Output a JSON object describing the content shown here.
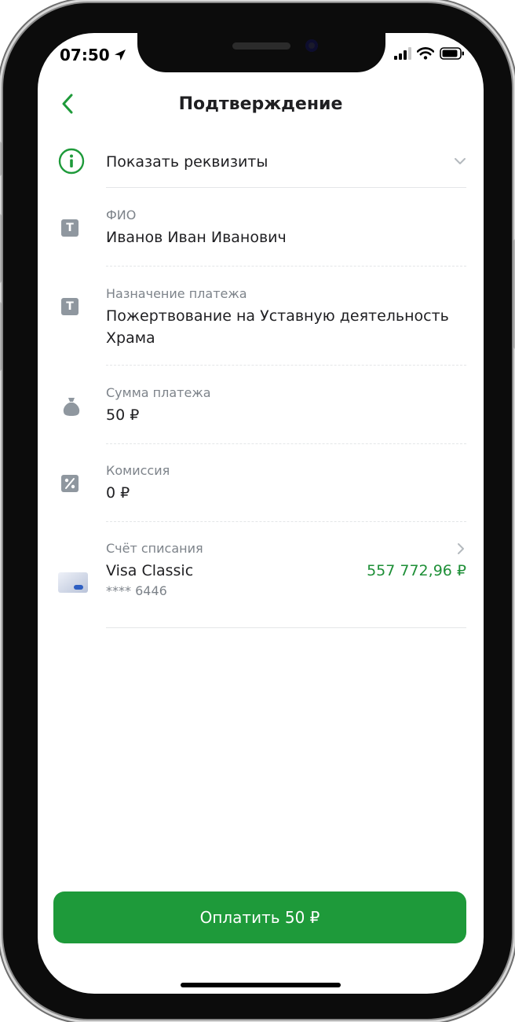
{
  "status_bar": {
    "time": "07:50"
  },
  "header": {
    "title": "Подтверждение"
  },
  "details_toggle": {
    "label": "Показать реквизиты"
  },
  "fields": {
    "fio": {
      "label": "ФИО",
      "value": "Иванов Иван Иванович"
    },
    "purpose": {
      "label": "Назначение платежа",
      "value_line1": "Пожертвование на Уставную деятельность",
      "value_line2": "Храма"
    },
    "amount": {
      "label": "Сумма платежа",
      "value": "50 ₽"
    },
    "commission": {
      "label": "Комиссия",
      "value": "0 ₽"
    },
    "account": {
      "label": "Счёт списания",
      "card_name": "Visa Classic",
      "card_number": "**** 6446",
      "balance": "557 772,96 ₽"
    }
  },
  "pay_button": {
    "label": "Оплатить 50 ₽"
  },
  "colors": {
    "accent": "#1e9a3a",
    "balance": "#1e8f37",
    "text": "#1f1f22",
    "muted": "#7d838a"
  }
}
